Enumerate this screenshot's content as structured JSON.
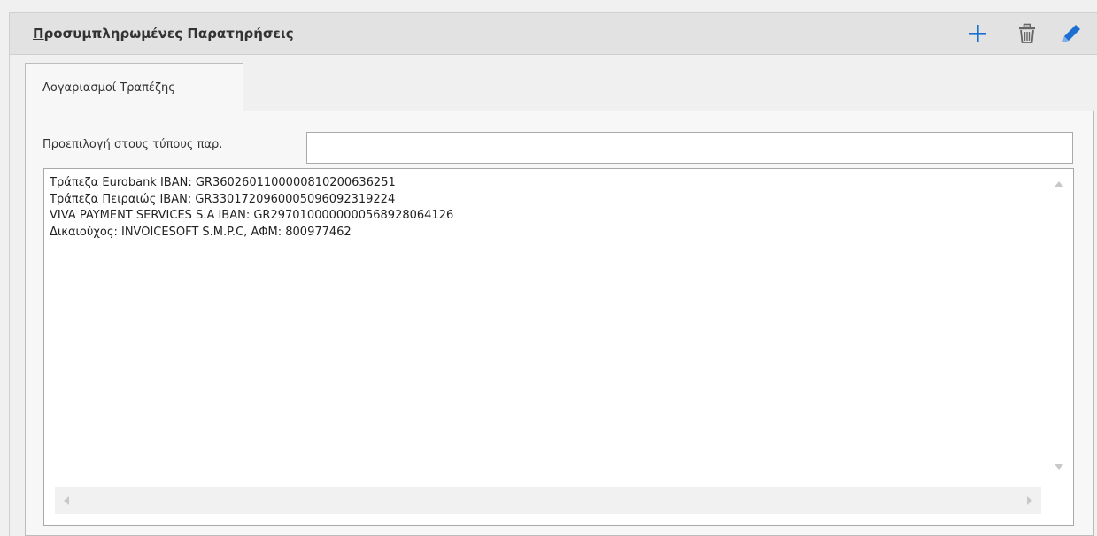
{
  "header": {
    "title_first_letter": "Π",
    "title_rest": "ροσυμπληρωμένες Παρατηρήσεις",
    "icons": [
      "plus-icon",
      "trash-icon",
      "pencil-icon"
    ],
    "accent_color": "#1c6fd1"
  },
  "tabs": [
    {
      "label": "Λογαριασμοί Τραπέζης",
      "active": true
    }
  ],
  "form": {
    "preselect_label": "Προεπιλογή στους τύπους παρ.",
    "preselect_value": "",
    "memo_lines": [
      "Τράπεζα Eurobank IBAN: GR3602601100000810200636251",
      "Τράπεζα Πειραιώς IBAN: GR3301720960005096092319224",
      "VIVA PAYMENT SERVICES S.A IBAN: GR2970100000000568928064126",
      "Δικαιούχος: INVOICESOFT S.M.P.C, ΑΦΜ: 800977462"
    ]
  }
}
